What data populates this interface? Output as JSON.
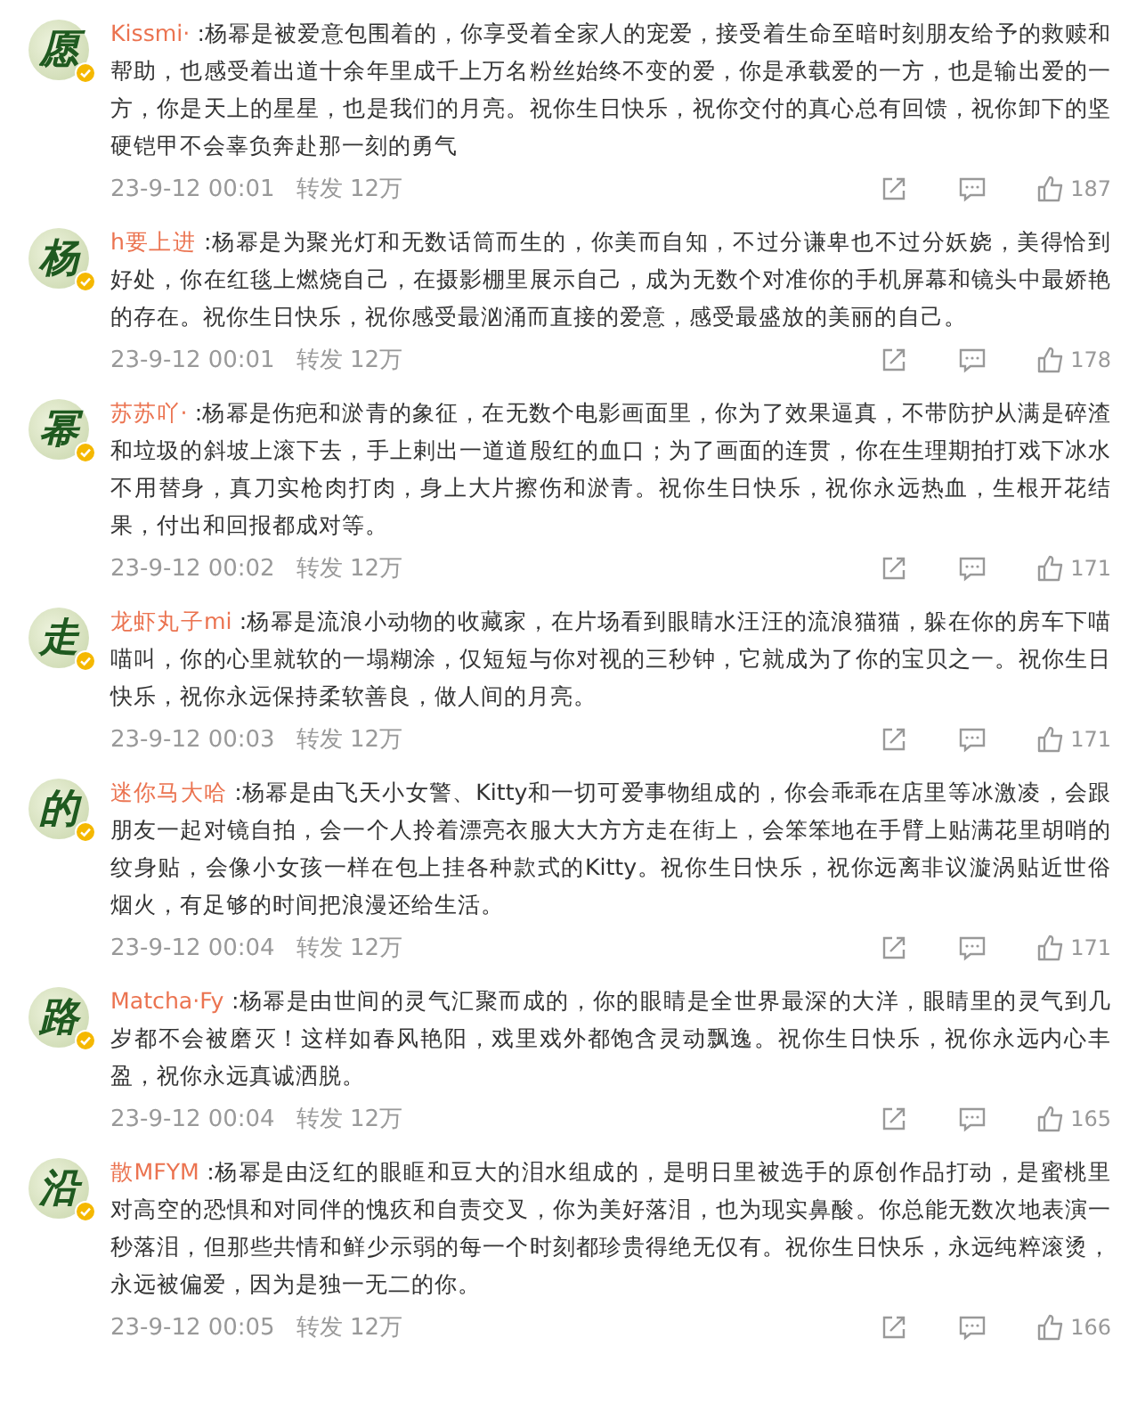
{
  "comments": [
    {
      "avatar_text": "愿",
      "verified": true,
      "user": "Kissmi·",
      "text": ":杨幂是被爱意包围着的，你享受着全家人的宠爱，接受着生命至暗时刻朋友给予的救赎和帮助，也感受着出道十余年里成千上万名粉丝始终不变的爱，你是承载爱的一方，也是输出爱的一方，你是天上的星星，也是我们的月亮。祝你生日快乐，祝你交付的真心总有回馈，祝你卸下的坚硬铠甲不会辜负奔赴那一刻的勇气",
      "time": "23-9-12 00:01",
      "repost": "转发 12万",
      "likes": "187"
    },
    {
      "avatar_text": "杨",
      "verified": true,
      "user": "h要上进",
      "text": ":杨幂是为聚光灯和无数话筒而生的，你美而自知，不过分谦卑也不过分妖娆，美得恰到好处，你在红毯上燃烧自己，在摄影棚里展示自己，成为无数个对准你的手机屏幕和镜头中最娇艳的存在。祝你生日快乐，祝你感受最汹涌而直接的爱意，感受最盛放的美丽的自己。",
      "time": "23-9-12 00:01",
      "repost": "转发 12万",
      "likes": "178"
    },
    {
      "avatar_text": "幂",
      "verified": true,
      "user": "苏苏吖·",
      "text": ":杨幂是伤疤和淤青的象征，在无数个电影画面里，你为了效果逼真，不带防护从满是碎渣和垃圾的斜坡上滚下去，手上剌出一道道殷红的血口；为了画面的连贯，你在生理期拍打戏下冰水不用替身，真刀实枪肉打肉，身上大片擦伤和淤青。祝你生日快乐，祝你永远热血，生根开花结果，付出和回报都成对等。",
      "time": "23-9-12 00:02",
      "repost": "转发 12万",
      "likes": "171"
    },
    {
      "avatar_text": "走",
      "verified": true,
      "user": "龙虾丸子mi",
      "text": ":杨幂是流浪小动物的收藏家，在片场看到眼睛水汪汪的流浪猫猫，躲在你的房车下喵喵叫，你的心里就软的一塌糊涂，仅短短与你对视的三秒钟，它就成为了你的宝贝之一。祝你生日快乐，祝你永远保持柔软善良，做人间的月亮。",
      "time": "23-9-12 00:03",
      "repost": "转发 12万",
      "likes": "171"
    },
    {
      "avatar_text": "的",
      "verified": true,
      "user": "迷你马大哈",
      "text": ":杨幂是由飞天小女警、Kitty和一切可爱事物组成的，你会乖乖在店里等冰激凌，会跟朋友一起对镜自拍，会一个人拎着漂亮衣服大大方方走在街上，会笨笨地在手臂上贴满花里胡哨的纹身贴，会像小女孩一样在包上挂各种款式的Kitty。祝你生日快乐，祝你远离非议漩涡贴近世俗烟火，有足够的时间把浪漫还给生活。",
      "time": "23-9-12 00:04",
      "repost": "转发 12万",
      "likes": "171"
    },
    {
      "avatar_text": "路",
      "verified": true,
      "user": "Matcha·Fy",
      "text": ":杨幂是由世间的灵气汇聚而成的，你的眼睛是全世界最深的大洋，眼睛里的灵气到几岁都不会被磨灭！这样如春风艳阳，戏里戏外都饱含灵动飘逸。祝你生日快乐，祝你永远内心丰盈，祝你永远真诚洒脱。",
      "time": "23-9-12 00:04",
      "repost": "转发 12万",
      "likes": "165"
    },
    {
      "avatar_text": "沿",
      "verified": true,
      "user": "散MFYM",
      "text": ":杨幂是由泛红的眼眶和豆大的泪水组成的，是明日里被选手的原创作品打动，是蜜桃里对高空的恐惧和对同伴的愧疚和自责交叉，你为美好落泪，也为现实鼻酸。你总能无数次地表演一秒落泪，但那些共情和鲜少示弱的每一个时刻都珍贵得绝无仅有。祝你生日快乐，永远纯粹滚烫，永远被偏爱，因为是独一无二的你。",
      "time": "23-9-12 00:05",
      "repost": "转发 12万",
      "likes": "166"
    }
  ]
}
